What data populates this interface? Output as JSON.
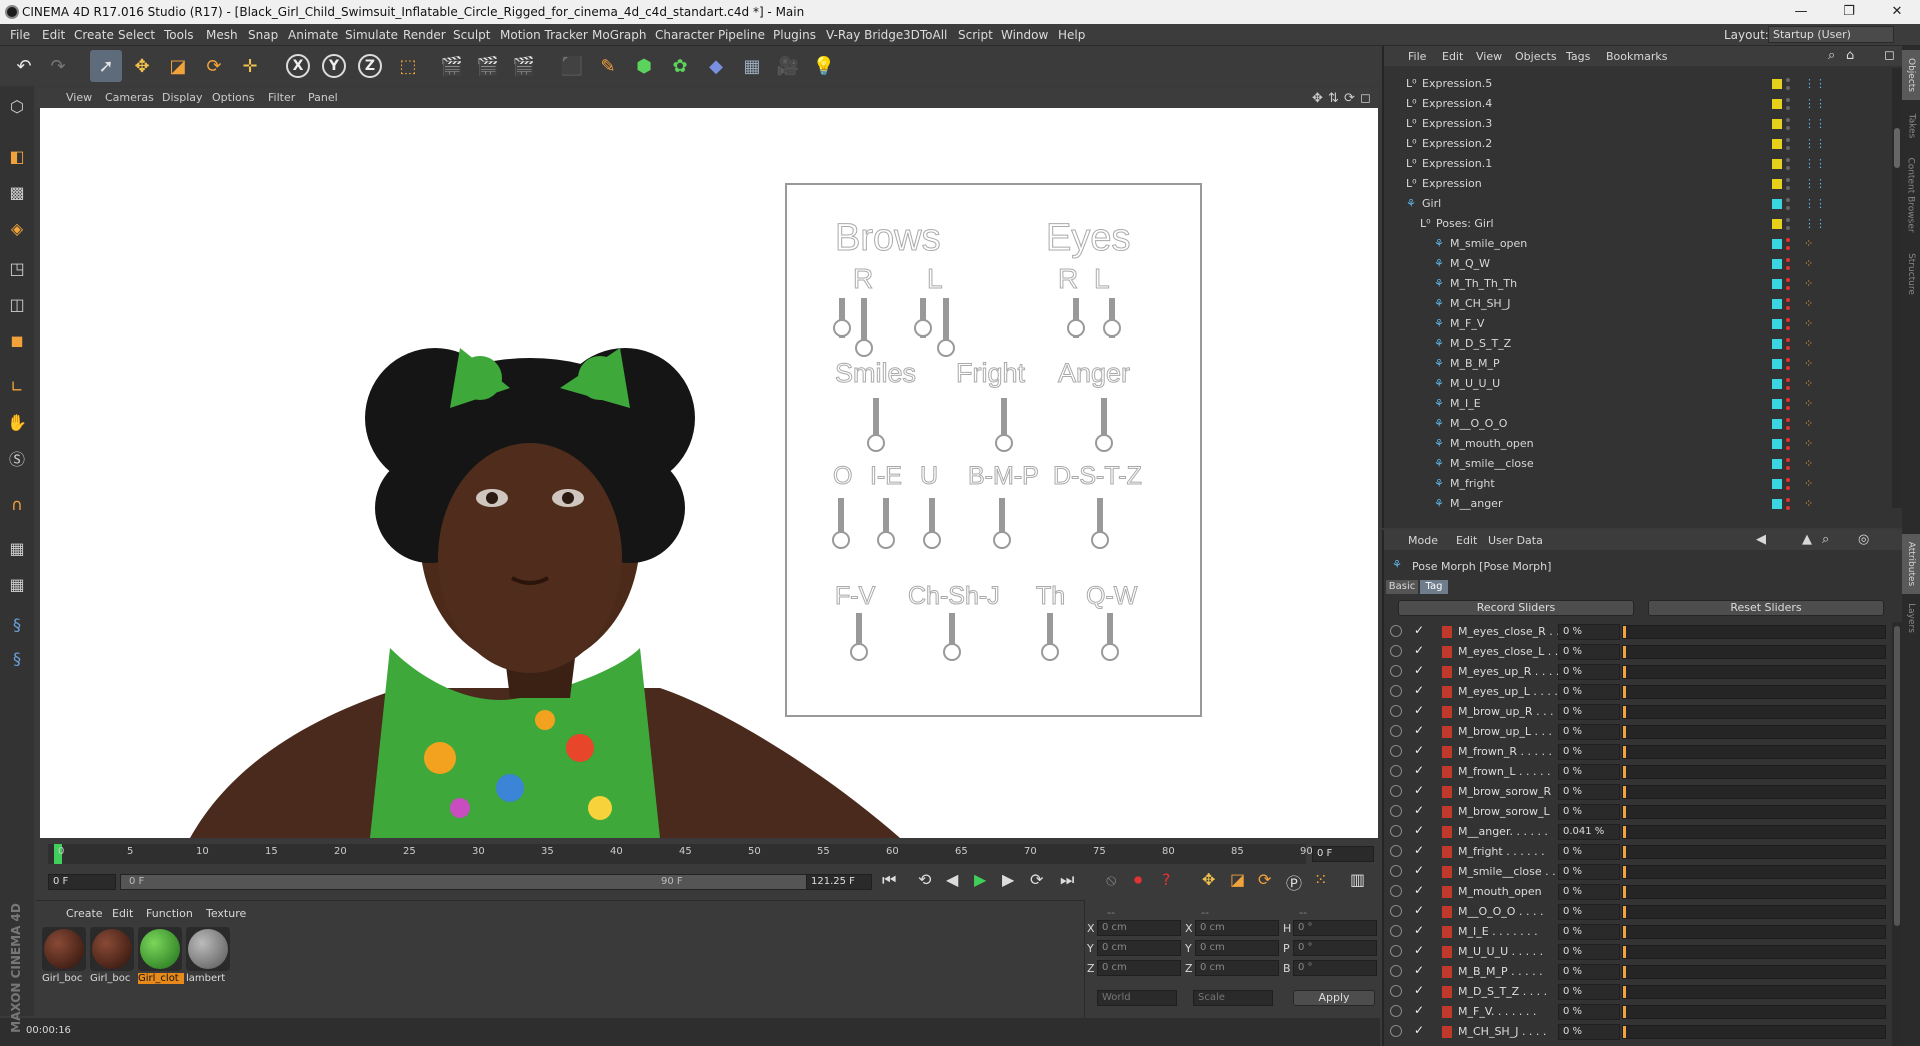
{
  "window": {
    "title": "CINEMA 4D R17.016 Studio (R17) - [Black_Girl_Child_Swimsuit_Inflatable_Circle_Rigged_for_cinema_4d_c4d_standart.c4d *] - Main",
    "minimize": "—",
    "maximize": "❐",
    "close": "✕"
  },
  "menu": [
    "File",
    "Edit",
    "Create",
    "Select",
    "Tools",
    "Mesh",
    "Snap",
    "Animate",
    "Simulate",
    "Render",
    "Sculpt",
    "Motion Tracker",
    "MoGraph",
    "Character",
    "Pipeline",
    "Plugins",
    "V-Ray Bridge",
    "3DToAll",
    "Script",
    "Window",
    "Help"
  ],
  "layout": {
    "label": "Layout:",
    "value": "Startup (User)"
  },
  "axes": [
    "X",
    "Y",
    "Z"
  ],
  "viewport": {
    "menu": [
      "View",
      "Cameras",
      "Display",
      "Options",
      "Filter",
      "Panel"
    ]
  },
  "rig": {
    "brows_title": "Brows",
    "eyes_title": "Eyes",
    "r": "R",
    "l": "L",
    "r2": "R",
    "l2": "L",
    "smiles": "Smiles",
    "fright": "Fright",
    "anger": "Anger",
    "o": "O",
    "ie": "I-E",
    "u": "U",
    "bmp": "B-M-P",
    "dstz": "D-S-T-Z",
    "fv": "F-V",
    "chshj": "Ch-Sh-J",
    "th": "Th",
    "qw": "Q-W"
  },
  "timeline": {
    "ticks": [
      "0",
      "5",
      "10",
      "15",
      "20",
      "25",
      "30",
      "35",
      "40",
      "45",
      "50",
      "55",
      "60",
      "65",
      "70",
      "75",
      "80",
      "85",
      "90"
    ],
    "frame_field": "0 F",
    "start": "0 F",
    "range_start": "0 F",
    "range_end": "90 F",
    "end": "121.25 F"
  },
  "materials": {
    "menu": [
      "Create",
      "Edit",
      "Function",
      "Texture"
    ],
    "items": [
      {
        "name": "Girl_boc"
      },
      {
        "name": "Girl_boc"
      },
      {
        "name": "Girl_clot"
      },
      {
        "name": "lambert"
      }
    ]
  },
  "coords": {
    "headers": [
      "--",
      "--",
      "--"
    ],
    "rows": [
      {
        "a": "X",
        "av": "0 cm",
        "b": "X",
        "bv": "0 cm",
        "c": "H",
        "cv": "0 °"
      },
      {
        "a": "Y",
        "av": "0 cm",
        "b": "Y",
        "bv": "0 cm",
        "c": "P",
        "cv": "0 °"
      },
      {
        "a": "Z",
        "av": "0 cm",
        "b": "Z",
        "bv": "0 cm",
        "c": "B",
        "cv": "0 °"
      }
    ],
    "world": "World",
    "scale": "Scale",
    "apply": "Apply"
  },
  "status": {
    "time": "00:00:16",
    "brand": "MAXON CINEMA 4D"
  },
  "objects": {
    "menu": [
      "File",
      "Edit",
      "View",
      "Objects",
      "Tags",
      "Bookmarks"
    ],
    "items": [
      {
        "name": "Expression.5",
        "level": 0,
        "type": "null",
        "color": "#e6d21c"
      },
      {
        "name": "Expression.4",
        "level": 0,
        "type": "null",
        "color": "#e6d21c"
      },
      {
        "name": "Expression.3",
        "level": 0,
        "type": "null",
        "color": "#e6d21c"
      },
      {
        "name": "Expression.2",
        "level": 0,
        "type": "null",
        "color": "#e6d21c"
      },
      {
        "name": "Expression.1",
        "level": 0,
        "type": "null",
        "color": "#e6d21c"
      },
      {
        "name": "Expression",
        "level": 0,
        "type": "null",
        "color": "#e6d21c"
      },
      {
        "name": "Girl",
        "level": 0,
        "type": "joint",
        "color": "#3ad6e0"
      },
      {
        "name": "Poses: Girl",
        "level": 1,
        "type": "null",
        "color": "#e6d21c"
      },
      {
        "name": "M_smile_open",
        "level": 2,
        "type": "joint",
        "color": "#3ad6e0"
      },
      {
        "name": "M_Q_W",
        "level": 2,
        "type": "joint",
        "color": "#3ad6e0"
      },
      {
        "name": "M_Th_Th_Th",
        "level": 2,
        "type": "joint",
        "color": "#3ad6e0"
      },
      {
        "name": "M_CH_SH_J",
        "level": 2,
        "type": "joint",
        "color": "#3ad6e0"
      },
      {
        "name": "M_F_V",
        "level": 2,
        "type": "joint",
        "color": "#3ad6e0"
      },
      {
        "name": "M_D_S_T_Z",
        "level": 2,
        "type": "joint",
        "color": "#3ad6e0"
      },
      {
        "name": "M_B_M_P",
        "level": 2,
        "type": "joint",
        "color": "#3ad6e0"
      },
      {
        "name": "M_U_U_U",
        "level": 2,
        "type": "joint",
        "color": "#3ad6e0"
      },
      {
        "name": "M_I_E",
        "level": 2,
        "type": "joint",
        "color": "#3ad6e0"
      },
      {
        "name": "M__O_O_O",
        "level": 2,
        "type": "joint",
        "color": "#3ad6e0"
      },
      {
        "name": "M_mouth_open",
        "level": 2,
        "type": "joint",
        "color": "#3ad6e0"
      },
      {
        "name": "M_smile__close",
        "level": 2,
        "type": "joint",
        "color": "#3ad6e0"
      },
      {
        "name": "M_fright",
        "level": 2,
        "type": "joint",
        "color": "#3ad6e0"
      },
      {
        "name": "M__anger",
        "level": 2,
        "type": "joint",
        "color": "#3ad6e0"
      }
    ]
  },
  "attributes": {
    "menu": [
      "Mode",
      "Edit",
      "User Data"
    ],
    "title": "Pose Morph [Pose Morph]",
    "tabs": [
      "Basic",
      "Tag"
    ],
    "record": "Record Sliders",
    "reset": "Reset Sliders",
    "sliders": [
      {
        "name": "M_eyes_close_R . .",
        "value": "0 %"
      },
      {
        "name": "M_eyes_close_L . .",
        "value": "0 %"
      },
      {
        "name": "M_eyes_up_R . . . .",
        "value": "0 %"
      },
      {
        "name": "M_eyes_up_L . . . .",
        "value": "0 %"
      },
      {
        "name": "M_brow_up_R . . .",
        "value": "0 %"
      },
      {
        "name": "M_brow_up_L . . .",
        "value": "0 %"
      },
      {
        "name": "M_frown_R . . . . .",
        "value": "0 %"
      },
      {
        "name": "M_frown_L . . . . .",
        "value": "0 %"
      },
      {
        "name": "M_brow_sorow_R",
        "value": "0 %"
      },
      {
        "name": "M_brow_sorow_L",
        "value": "0 %"
      },
      {
        "name": "M__anger. . . . . .",
        "value": "0.041 %"
      },
      {
        "name": "M_fright . . . . . .",
        "value": "0 %"
      },
      {
        "name": "M_smile__close . .",
        "value": "0 %"
      },
      {
        "name": "M_mouth_open",
        "value": "0 %"
      },
      {
        "name": "M__O_O_O . . . .",
        "value": "0 %"
      },
      {
        "name": "M_I_E . . . . . . .",
        "value": "0 %"
      },
      {
        "name": "M_U_U_U . . . . .",
        "value": "0 %"
      },
      {
        "name": "M_B_M_P . . . . .",
        "value": "0 %"
      },
      {
        "name": "M_D_S_T_Z . . . .",
        "value": "0 %"
      },
      {
        "name": "M_F_V. . . . . . .",
        "value": "0 %"
      },
      {
        "name": "M_CH_SH_J . . . .",
        "value": "0 %"
      }
    ]
  },
  "side_tabs": [
    "Objects",
    "Takes",
    "Content Browser",
    "Structure",
    "Attributes",
    "Layers"
  ]
}
